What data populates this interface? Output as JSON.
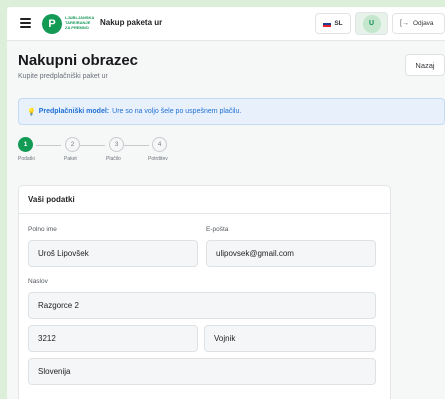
{
  "header": {
    "title": "Nakup paketa ur",
    "logo_mark": "P",
    "logo_text": [
      "LJUBLJANSKA",
      "TAREIRANJE",
      "ZA PREMNO"
    ],
    "language": "SL",
    "user_initial": "U",
    "logout_label": "Odjava",
    "flag_colors": [
      "#ffffff",
      "#1c3f94",
      "#e6202b"
    ]
  },
  "page": {
    "title": "Nakupni obrazec",
    "subtitle": "Kupite predplačniški paket ur",
    "back_label": "Nazaj"
  },
  "banner": {
    "icon": "lightbulb-icon",
    "strong": "Predplačniški model:",
    "text": "Ure so na voljo šele po uspešnem plačilu."
  },
  "steps": [
    {
      "number": "1",
      "label": "Podatki",
      "active": true
    },
    {
      "number": "2",
      "label": "Paket",
      "active": false
    },
    {
      "number": "3",
      "label": "Plačilo",
      "active": false
    },
    {
      "number": "4",
      "label": "Potrditev",
      "active": false
    }
  ],
  "form": {
    "card_title": "Vaši podatki",
    "full_name_label": "Polno ime",
    "full_name_value": "Uroš Lipovšek",
    "email_label": "E-pošta",
    "email_value": "ulipovsek@gmail.com",
    "address_label": "Naslov",
    "street_value": "Razgorce 2",
    "postal_value": "3212",
    "city_value": "Vojnik",
    "country_value": "Slovenija"
  },
  "colors": {
    "brand": "#139a55",
    "info_text": "#1f6fd6",
    "info_bg": "#e8f1fb"
  }
}
